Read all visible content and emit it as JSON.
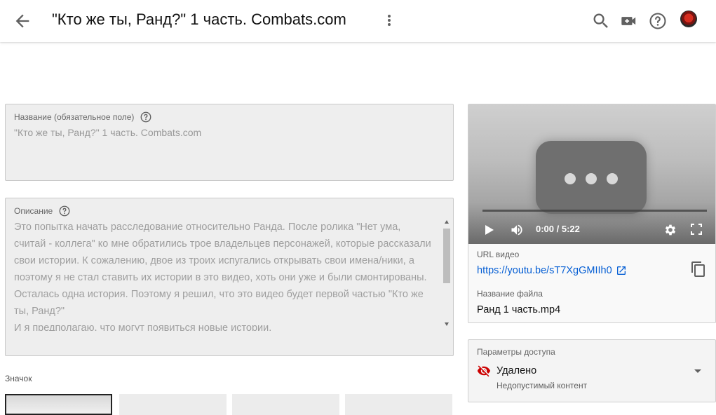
{
  "header": {
    "title": "\"Кто же ты, Ранд?\" 1 часть. Combats.com"
  },
  "title_field": {
    "label": "Название (обязательное поле)",
    "value": "\"Кто же ты, Ранд?\" 1 часть. Combats.com"
  },
  "description_field": {
    "label": "Описание",
    "lines": [
      "Это попытка начать расследование относительно Ранда. После ролика \"Нет ума, считай - коллега\" ко мне обратились трое владельцев персонажей, которые рассказали свои истории. К сожалению, двое из троих испугались открывать свои имена/ники, а поэтому я не стал ставить их истории в это видео, хоть они уже и были смонтированы. Осталась одна история. Поэтому я решил, что это видео будет первой частью \"Кто же ты, Ранд?\"",
      "И я предполагаю, что могут появиться новые истории."
    ]
  },
  "thumbnails": {
    "label": "Значок"
  },
  "video": {
    "time": "0:00 / 5:22",
    "url_label": "URL видео",
    "url": "https://youtu.be/sT7XgGMIIh0",
    "filename_label": "Название файла",
    "filename": "Ранд 1 часть.mp4"
  },
  "visibility": {
    "label": "Параметры доступа",
    "status": "Удалено",
    "reason": "Недопустимый контент",
    "status_color": "#cc0000"
  },
  "icons": {
    "back": "arrow-left-icon",
    "more": "more-vert-icon",
    "search": "search-icon",
    "create": "video-add-icon",
    "help": "help-circle-icon"
  }
}
